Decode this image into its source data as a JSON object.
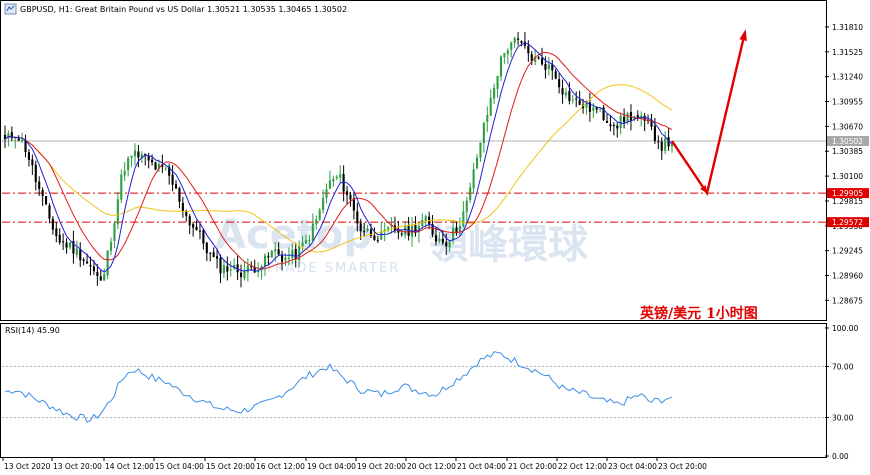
{
  "header": {
    "symbol_line": "GBPUSD, H1:  Great Britain Pound vs US Dollar  1.30521 1.30535 1.30465 1.30502"
  },
  "rsi_label": "RSI(14) 45.90",
  "annotation": "英镑/美元 1小时图",
  "watermark": {
    "brand": "Acetop",
    "chinese": "領峰環球",
    "tagline": "TRADE SMARTER"
  },
  "colors": {
    "bull": "#2ea043",
    "bear": "#000000",
    "ma_fast": "#1f1fd8",
    "ma_mid": "#e01b1b",
    "ma_slow": "#f0c419",
    "rsi": "#3d8ee6",
    "arrow": "#e00000",
    "level": "#e00000"
  },
  "chart_data": [
    {
      "type": "candlestick",
      "title": "GBPUSD, H1",
      "ylim": [
        1.2845,
        1.3205
      ],
      "y_ticks": [
        "1.31810",
        "1.31525",
        "1.31240",
        "1.30955",
        "1.30670",
        "1.30385",
        "1.30100",
        "1.29815",
        "1.29530",
        "1.29245",
        "1.28960",
        "1.28675"
      ],
      "x_ticks": [
        "13 Oct 2020",
        "13 Oct 20:00",
        "14 Oct 12:00",
        "15 Oct 04:00",
        "15 Oct 20:00",
        "16 Oct 12:00",
        "19 Oct 04:00",
        "19 Oct 20:00",
        "20 Oct 12:00",
        "21 Oct 04:00",
        "21 Oct 20:00",
        "22 Oct 12:00",
        "23 Oct 04:00",
        "23 Oct 20:00"
      ],
      "current_price": "1.30502",
      "levels": [
        {
          "value": 1.29905,
          "label": "1.29905"
        },
        {
          "value": 1.29572,
          "label": "1.29572"
        }
      ],
      "close_path": [
        1.305,
        1.306,
        1.304,
        1.3,
        1.2965,
        1.2935,
        1.293,
        1.292,
        1.2905,
        1.2885,
        1.295,
        1.302,
        1.3035,
        1.303,
        1.302,
        1.3015,
        1.299,
        1.296,
        1.2945,
        1.292,
        1.2905,
        1.2905,
        1.29,
        1.2905,
        1.291,
        1.2925,
        1.2915,
        1.292,
        1.2935,
        1.296,
        1.3,
        1.301,
        1.2985,
        1.295,
        1.2945,
        1.294,
        1.295,
        1.2945,
        1.295,
        1.296,
        1.294,
        1.2935,
        1.295,
        1.298,
        1.304,
        1.309,
        1.314,
        1.3165,
        1.316,
        1.3145,
        1.314,
        1.313,
        1.3105,
        1.3095,
        1.309,
        1.3085,
        1.3075,
        1.307,
        1.308,
        1.3075,
        1.3065,
        1.3045,
        1.305
      ],
      "series": [
        {
          "name": "MA fast"
        },
        {
          "name": "MA mid"
        },
        {
          "name": "MA slow"
        }
      ],
      "projection": [
        "1.30502",
        "1.29905",
        "1.3175"
      ]
    },
    {
      "type": "line",
      "title": "RSI(14) 45.90",
      "ylim": [
        0,
        100
      ],
      "y_ticks": [
        "100.00",
        "70.00",
        "30.00",
        "0.00"
      ],
      "levels": [
        70,
        30
      ],
      "series": [
        {
          "values": [
            50,
            52,
            48,
            44,
            40,
            36,
            32,
            30,
            28,
            34,
            46,
            62,
            68,
            64,
            60,
            58,
            52,
            48,
            44,
            40,
            37,
            36,
            35,
            38,
            40,
            44,
            50,
            56,
            62,
            66,
            70,
            64,
            58,
            52,
            50,
            48,
            52,
            55,
            52,
            50,
            48,
            54,
            60,
            66,
            74,
            78,
            80,
            76,
            72,
            68,
            64,
            58,
            52,
            50,
            48,
            44,
            42,
            40,
            44,
            48,
            42,
            44,
            45.9
          ]
        }
      ]
    }
  ]
}
